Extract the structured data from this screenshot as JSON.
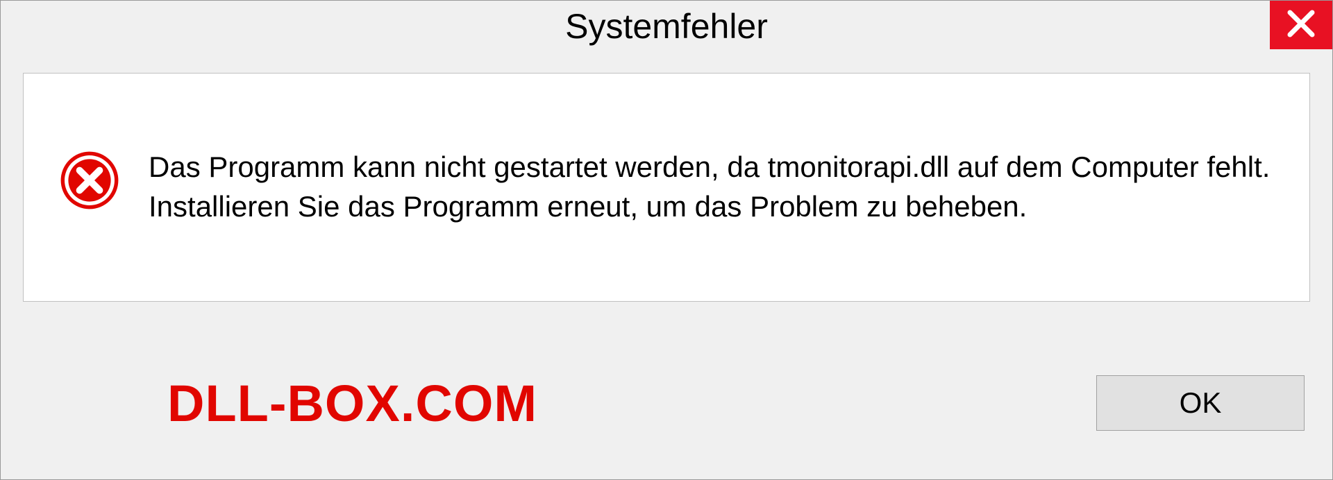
{
  "dialog": {
    "title": "Systemfehler",
    "message": "Das Programm kann nicht gestartet werden, da tmonitorapi.dll auf dem Computer fehlt. Installieren Sie das Programm erneut, um das Problem zu beheben.",
    "ok_label": "OK"
  },
  "watermark": "DLL-BOX.COM",
  "colors": {
    "close_bg": "#e81123",
    "error_icon": "#e10600",
    "watermark": "#e10600"
  }
}
